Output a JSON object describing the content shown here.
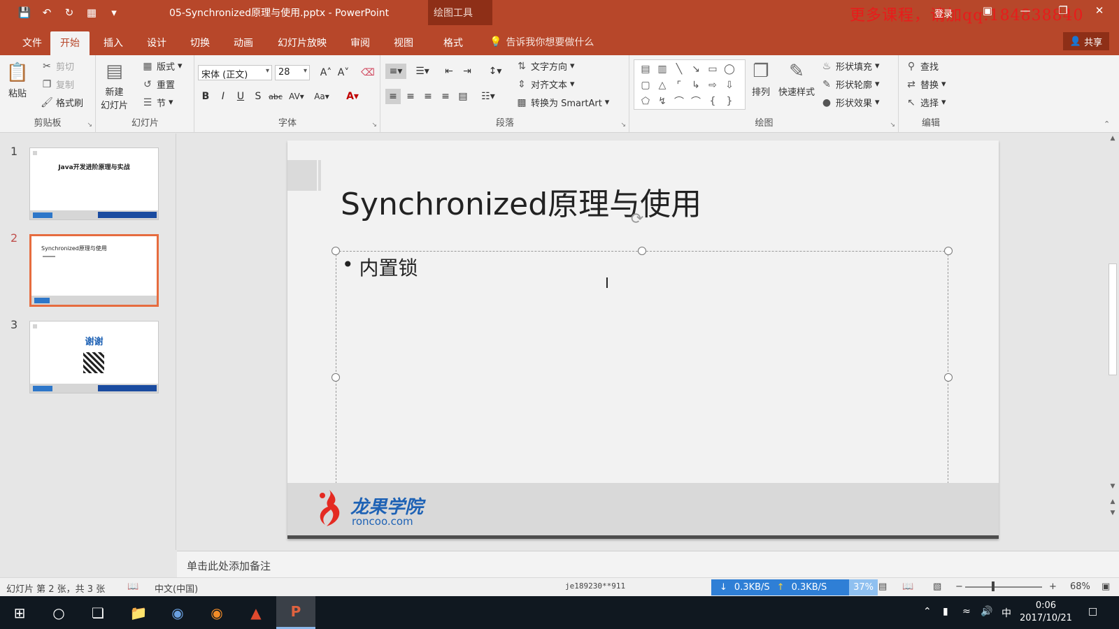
{
  "window": {
    "doc_title": "05-Synchronized原理与使用.pptx - PowerPoint",
    "context_tool": "绘图工具",
    "watermark": "更多课程，请加qq:184838840",
    "login": "登录",
    "share": "共享"
  },
  "tabs": [
    "文件",
    "开始",
    "插入",
    "设计",
    "切换",
    "动画",
    "幻灯片放映",
    "审阅",
    "视图",
    "格式"
  ],
  "active_tab": "开始",
  "tell_me": "告诉我你想要做什么",
  "ribbon": {
    "clipboard": {
      "label": "剪贴板",
      "paste": "粘贴",
      "cut": "剪切",
      "copy": "复制",
      "format_painter": "格式刷"
    },
    "slides": {
      "label": "幻灯片",
      "new_slide_1": "新建",
      "new_slide_2": "幻灯片",
      "layout": "版式",
      "reset": "重置",
      "section": "节"
    },
    "font": {
      "label": "字体",
      "font_name": "宋体 (正文)",
      "font_size": "28"
    },
    "paragraph": {
      "label": "段落",
      "text_direction": "文字方向",
      "align_text": "对齐文本",
      "smartart": "转换为 SmartArt"
    },
    "drawing": {
      "label": "绘图",
      "arrange": "排列",
      "quick_styles": "快速样式",
      "shape_fill": "形状填充",
      "shape_outline": "形状轮廓",
      "shape_effects": "形状效果"
    },
    "editing": {
      "label": "编辑",
      "find": "查找",
      "replace": "替换",
      "select": "选择"
    }
  },
  "thumbnails": [
    {
      "num": "1",
      "title": "Java开发进阶原理与实战",
      "selected": false
    },
    {
      "num": "2",
      "title": "Synchronized原理与使用",
      "selected": true
    },
    {
      "num": "3",
      "title": "谢谢",
      "selected": false
    }
  ],
  "slide": {
    "title": "Synchronized原理与使用",
    "bullet": "内置锁",
    "logo_cn": "龙果学院",
    "logo_en": "roncoo.com"
  },
  "notes_placeholder": "单击此处添加备注",
  "status": {
    "slide_info": "幻灯片 第 2 张，共 3 张",
    "language": "中文(中国)",
    "user": "je189230**911",
    "net_down": "0.3KB/S",
    "net_up": "0.3KB/S",
    "net_pct": "37%",
    "zoom": "68%"
  },
  "taskbar": {
    "time": "0:06",
    "date": "2017/10/21",
    "ime": "中"
  },
  "colors": {
    "ppt_brand": "#b7472a",
    "context_tab": "#8e2f17",
    "selection_border": "#e66c3f",
    "logo_blue": "#1e62b5"
  }
}
